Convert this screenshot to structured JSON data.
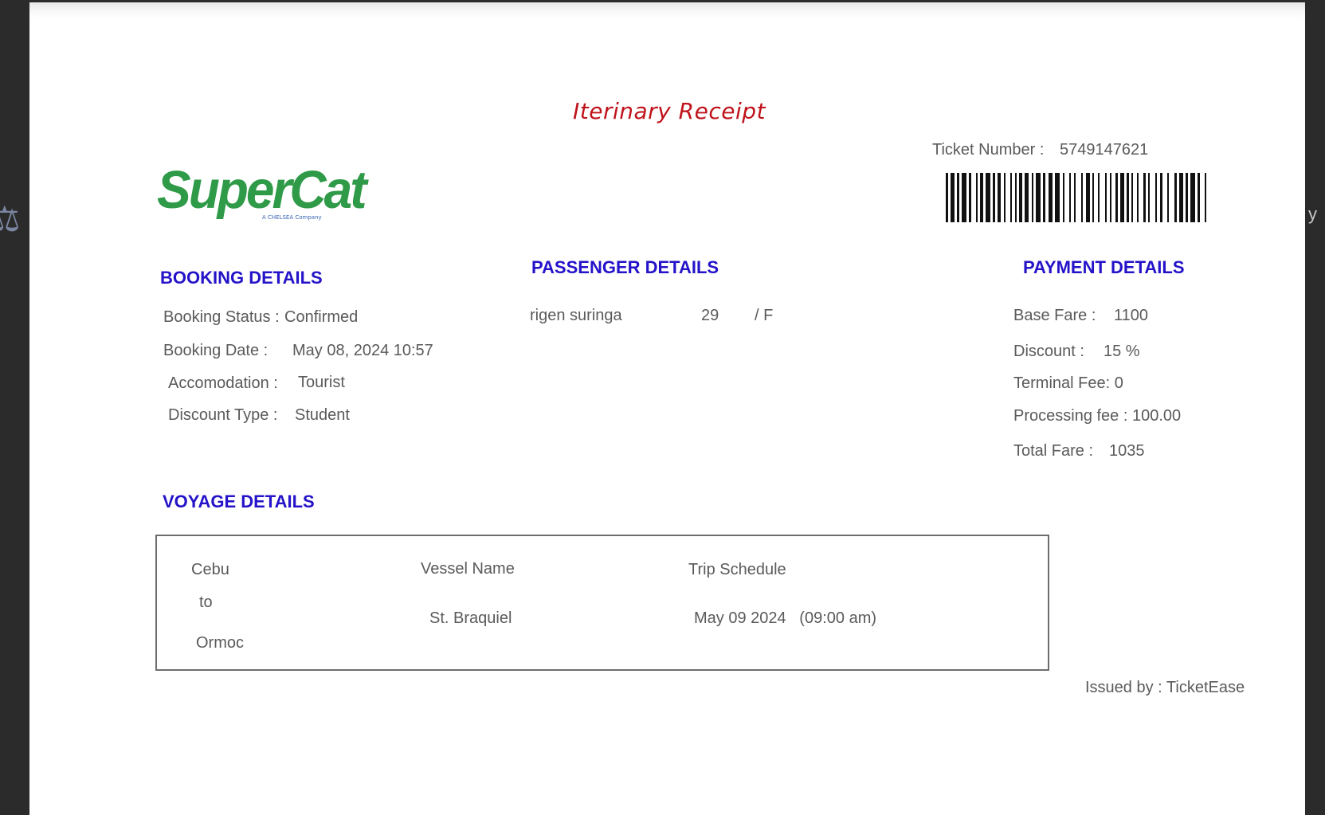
{
  "window": {
    "left_edge_icon": "dark-app-icon",
    "right_edge_text": "y"
  },
  "receipt": {
    "title": "Iterinary Receipt",
    "brand": {
      "logo_text": "SuperCat",
      "logo_tagline": "A CHELSEA Company",
      "logo_color": "#2f9a47"
    },
    "ticket": {
      "label": "Ticket Number :",
      "number": "5749147621"
    },
    "booking": {
      "heading": "BOOKING DETAILS",
      "status_label": "Booking Status :",
      "status_value": "Confirmed",
      "date_label": "Booking Date :",
      "date_value": "May 08, 2024 10:57",
      "accommodation_label": "Accomodation :",
      "accommodation_value": "Tourist",
      "discount_type_label": "Discount Type :",
      "discount_type_value": "Student"
    },
    "passenger": {
      "heading": "PASSENGER DETAILS",
      "name": "rigen suringa",
      "age": "29",
      "sex": "/  F"
    },
    "payment": {
      "heading": "PAYMENT DETAILS",
      "base_fare_label": "Base Fare :",
      "base_fare_value": "1100",
      "discount_label": "Discount :",
      "discount_value": "15 %",
      "terminal_fee": "Terminal Fee: 0",
      "processing_fee": "Processing fee : 100.00",
      "total_label": "Total Fare :",
      "total_value": "1035"
    },
    "voyage": {
      "heading": "VOYAGE DETAILS",
      "origin": "Cebu",
      "to": "to",
      "destination": "Ormoc",
      "vessel_label": "Vessel Name",
      "vessel_value": "St. Braquiel",
      "schedule_label": "Trip Schedule",
      "schedule_value": "May 09 2024   (09:00 am)"
    },
    "issued_by": "Issued by : TicketEase",
    "colors": {
      "heading": "#2413c8",
      "title": "#c0141c",
      "text": "#5a5a5a"
    }
  }
}
